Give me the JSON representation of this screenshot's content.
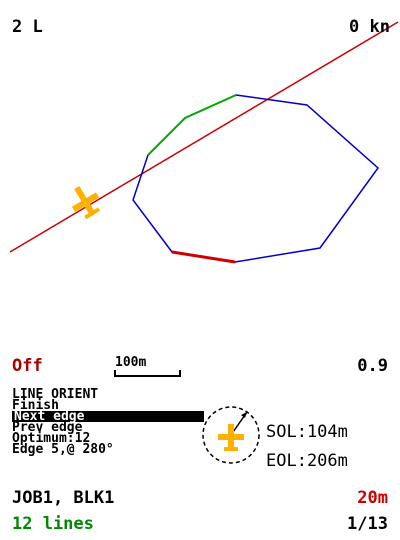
{
  "top_bar": {
    "left": "2 L",
    "right": "0 kn"
  },
  "status_bar": {
    "mode": "Off",
    "scale": "100m",
    "value": "0.9"
  },
  "menu": {
    "title": "LINE ORIENT",
    "items": [
      "Finish",
      "Next edge",
      "Prev edge",
      "Optimum:12",
      "Edge 5,@ 280°"
    ],
    "selected_index": 1
  },
  "readouts": {
    "sol": "SOL:104m",
    "eol": "EOL:206m"
  },
  "bottom": {
    "job": "JOB1, BLK1",
    "distance": "20m",
    "lines": "12 lines",
    "page": "1/13"
  },
  "colors": {
    "line": "#cc0000",
    "polygon": "#0000cc",
    "covered_edge": "#00aa00",
    "selected_edge": "#cc0000",
    "aircraft": "#ffb000",
    "status_off": "#aa0000",
    "lines_text": "#008800"
  },
  "icons": {
    "aircraft": "plane-icon",
    "compass": "compass-icon"
  }
}
